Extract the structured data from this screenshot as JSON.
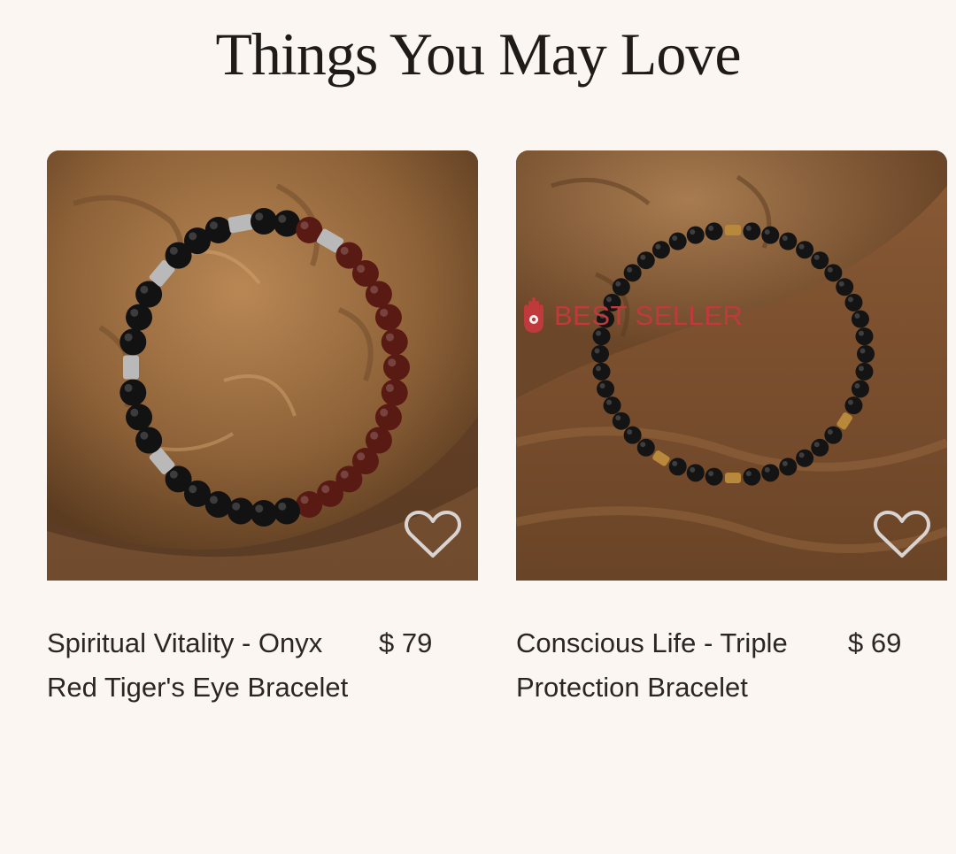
{
  "section_title": "Things You May Love",
  "products": [
    {
      "name": "Spiritual Vitality - Onyx Red Tiger's Eye Bracelet",
      "price": "$ 79",
      "wishlist_icon": "heart-outline-icon"
    },
    {
      "name": "Conscious Life - Triple Protection Bracelet",
      "price": "$ 69",
      "wishlist_icon": "heart-outline-icon",
      "badge": {
        "icon": "hamsa-hand-icon",
        "label": "BEST SELLER",
        "color": "#c0393c"
      }
    }
  ],
  "colors": {
    "background": "#fcf6f2",
    "text": "#2b2624",
    "accent": "#c0393c"
  }
}
